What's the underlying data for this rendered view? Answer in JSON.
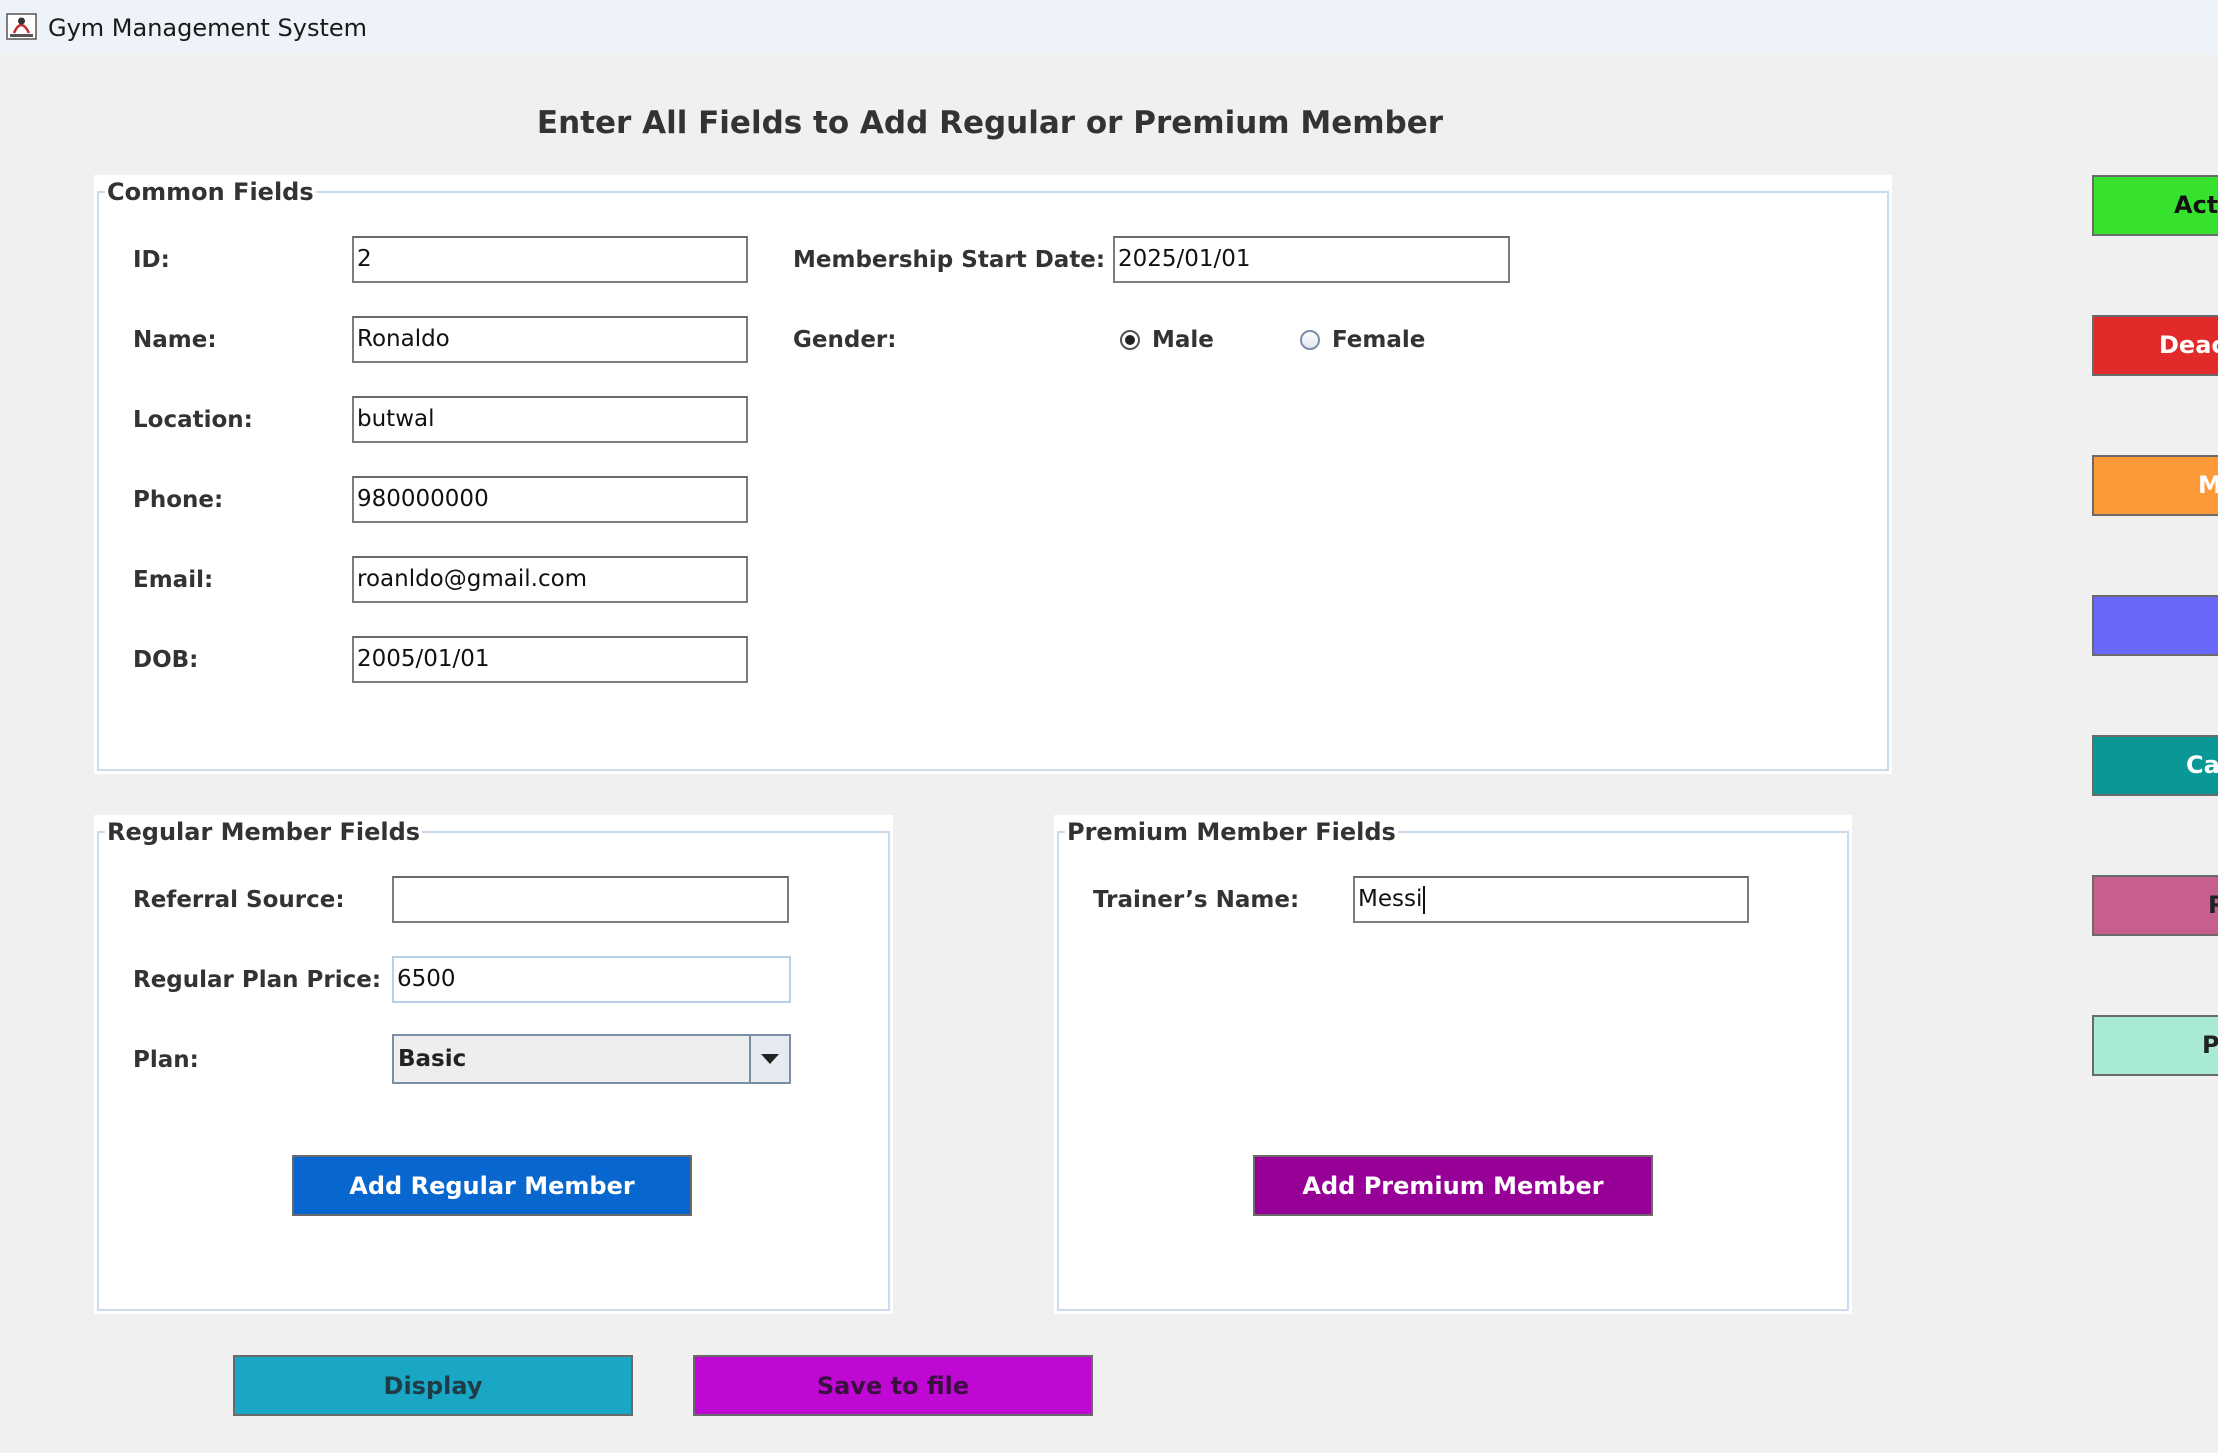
{
  "window": {
    "title": "Gym Management System",
    "icon": "java-app-icon"
  },
  "heading": "Enter All Fields to Add Regular or Premium Member",
  "common": {
    "legend": "Common Fields",
    "id_label": "ID:",
    "id_value": "2",
    "name_label": "Name:",
    "name_value": "Ronaldo",
    "location_label": "Location:",
    "location_value": "butwal",
    "phone_label": "Phone:",
    "phone_value": "980000000",
    "email_label": "Email:",
    "email_value": "roanldo@gmail.com",
    "dob_label": "DOB:",
    "dob_value": "2005/01/01",
    "start_label": "Membership Start Date:",
    "start_value": "2025/01/01",
    "gender_label": "Gender:",
    "gender_options": [
      "Male",
      "Female"
    ],
    "gender_selected": "Male"
  },
  "regular": {
    "legend": "Regular Member Fields",
    "referral_label": "Referral Source:",
    "referral_value": "",
    "price_label": "Regular Plan Price:",
    "price_value": "6500",
    "plan_label": "Plan:",
    "plan_value": "Basic",
    "add_button": "Add Regular Member"
  },
  "premium": {
    "legend": "Premium Member Fields",
    "trainer_label": "Trainer’s Name:",
    "trainer_value": "Messi",
    "add_button": "Add Premium Member"
  },
  "bottom": {
    "display_button": "Display",
    "save_button": "Save to file"
  },
  "side_buttons": [
    {
      "label": "Acti",
      "color": "#37e22f"
    },
    {
      "label": "Deact",
      "color": "#e32a2a"
    },
    {
      "label": "M",
      "color": "#fd9a37"
    },
    {
      "label": "",
      "color": "#6a67fb"
    },
    {
      "label": "Cal",
      "color": "#0a9896"
    },
    {
      "label": "R",
      "color": "#c65e8e"
    },
    {
      "label": "P",
      "color": "#a9ead6"
    }
  ],
  "colors": {
    "regular_button": "#0866cf",
    "premium_button": "#960096",
    "display_button": "#1aa7c5",
    "save_button": "#c008d5"
  }
}
